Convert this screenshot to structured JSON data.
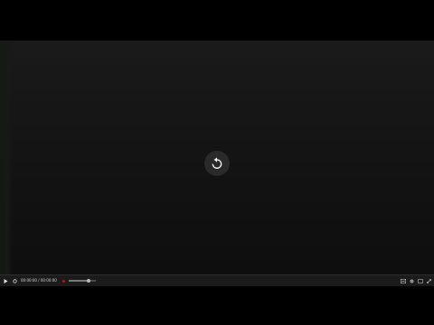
{
  "player": {
    "replay_icon": "replay-icon",
    "controls": {
      "play_icon": "play-icon",
      "restart_icon": "restart-icon",
      "time_text": "00:00:00 / 00:00:00",
      "progress_fraction": 0.75,
      "subtitles_icon": "captions-icon",
      "settings_icon": "gear-icon",
      "theater_icon": "theater-mode-icon",
      "fullscreen_icon": "fullscreen-icon"
    },
    "colors": {
      "video_bg": "#151515",
      "bar_bg": "#1b1b1b",
      "accent_red": "#e1001a"
    }
  }
}
